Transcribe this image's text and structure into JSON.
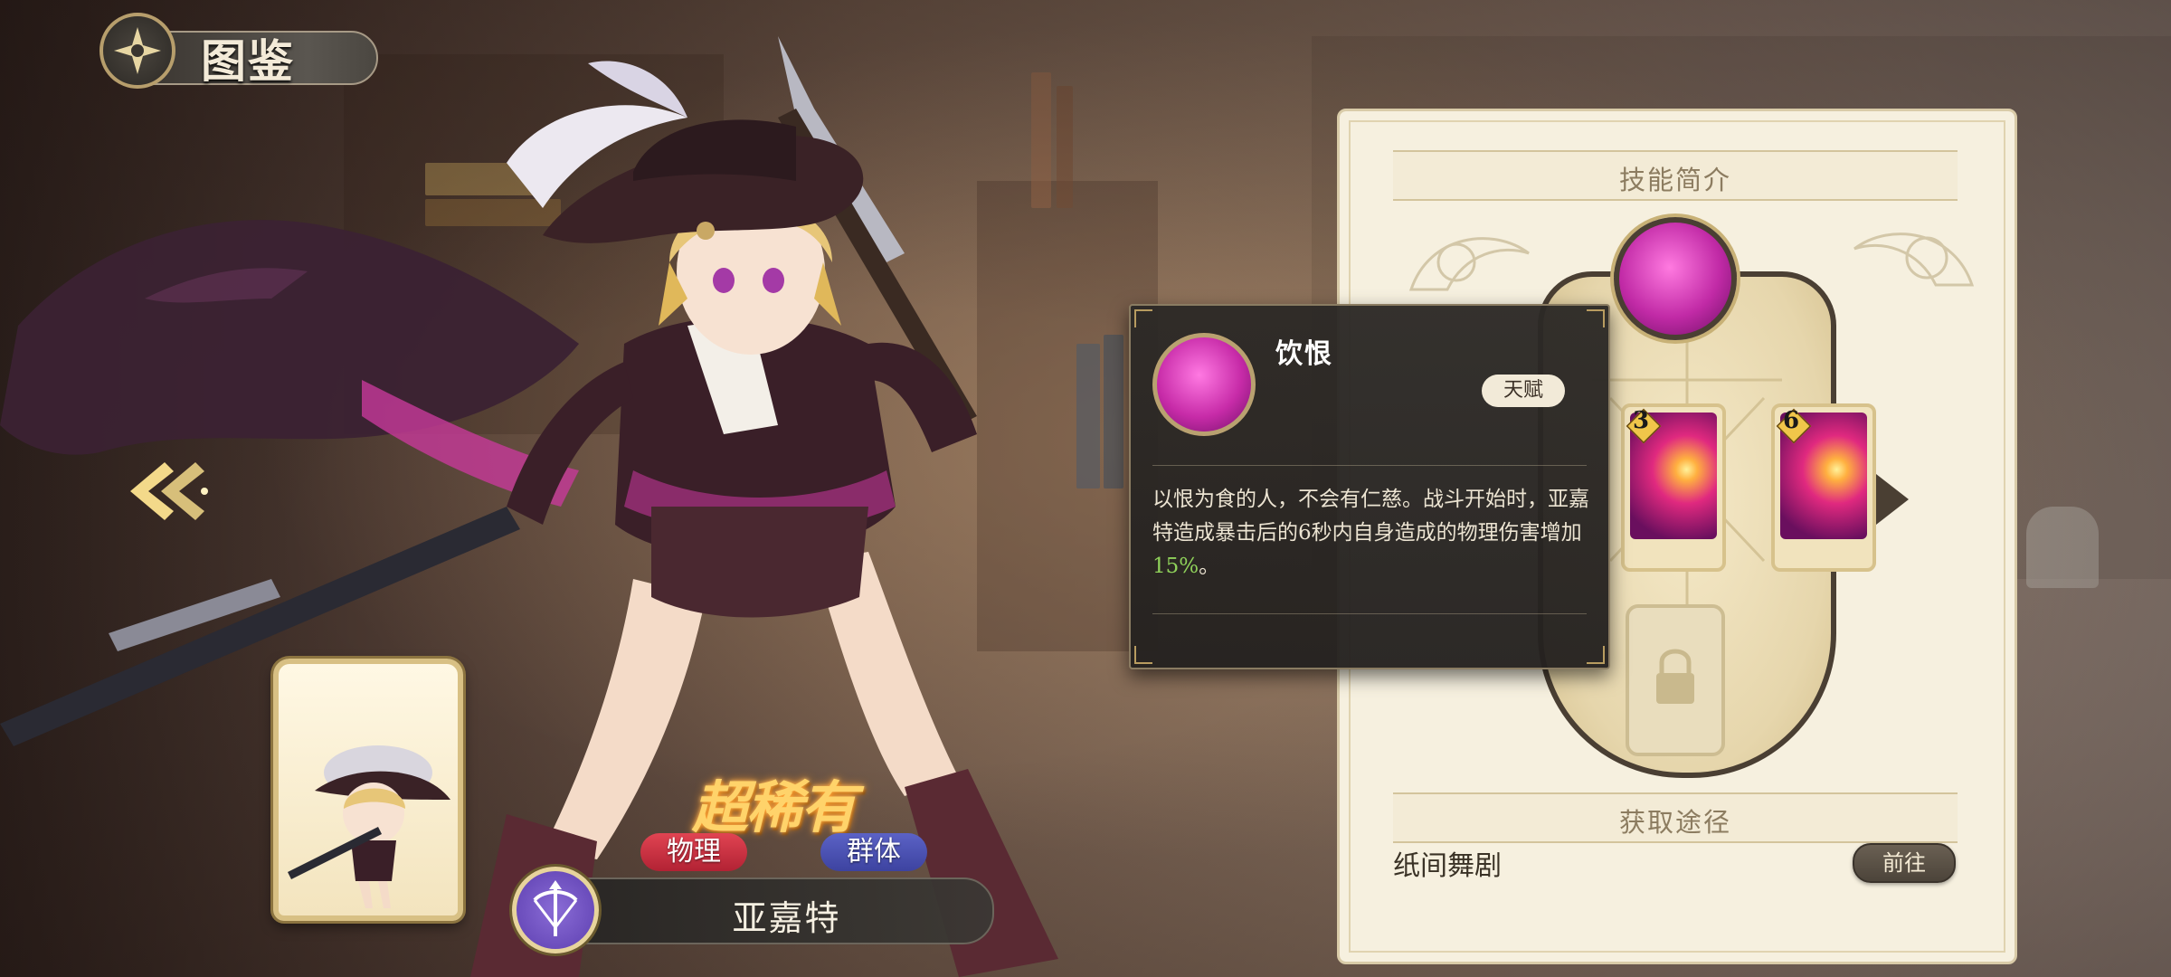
{
  "header": {
    "title": "图鉴"
  },
  "character": {
    "rarity": "超稀有",
    "tags": [
      "物理",
      "群体"
    ],
    "name": "亚嘉特"
  },
  "skill_panel": {
    "title": "技能简介",
    "nodes": [
      {
        "type": "orb"
      },
      {
        "type": "card",
        "badge": "3"
      },
      {
        "type": "card",
        "badge": "6"
      },
      {
        "type": "locked"
      }
    ]
  },
  "tooltip": {
    "name": "饮恨",
    "badge": "天赋",
    "description_before": "以恨为食的人，不会有仁慈。战斗开始时，亚嘉特造成暴击后的6秒内自身造成的物理伤害增加",
    "description_highlight": "15%",
    "description_after": "。",
    "highlight_color": "#8fd15a"
  },
  "acquire": {
    "title": "获取途径",
    "source": "纸间舞剧",
    "button_label": "前往"
  },
  "colors": {
    "panel_bg": "#f6f0df",
    "tooltip_bg": "#2c2926",
    "tag_physical": "#c92f3f",
    "tag_group": "#4a50b4",
    "rarity_gold": "#ffd36a"
  },
  "icons": [
    "compass-emblem-icon",
    "double-chevron-left-icon",
    "crossbow-class-icon",
    "lock-icon",
    "chevron-right-icon"
  ]
}
